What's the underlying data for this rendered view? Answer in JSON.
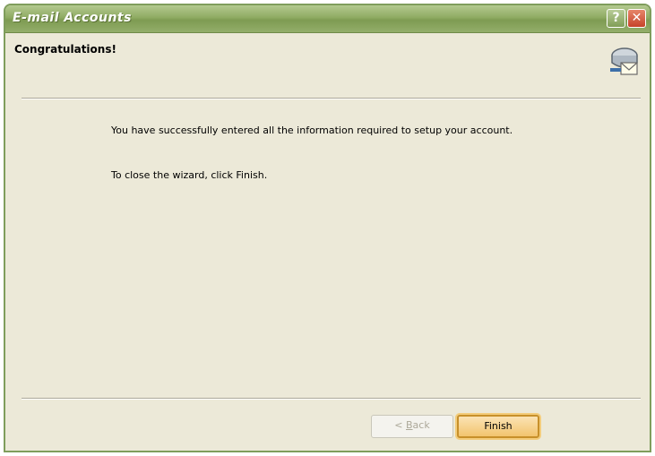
{
  "window": {
    "title": "E-mail Accounts",
    "help_glyph": "?",
    "close_glyph": "✕",
    "colors": {
      "titlebar": "#8fab63",
      "dialog_bg": "#ece9d8",
      "finish_highlight": "#f2c46e"
    }
  },
  "header": {
    "title": "Congratulations!",
    "icon": "email-accounts-icon"
  },
  "content": {
    "line1": "You have successfully entered all the information required to setup your account.",
    "line2": "To close the wizard, click Finish."
  },
  "buttons": {
    "back_prefix": "< ",
    "back_access": "B",
    "back_rest": "ack",
    "finish": "Finish"
  }
}
